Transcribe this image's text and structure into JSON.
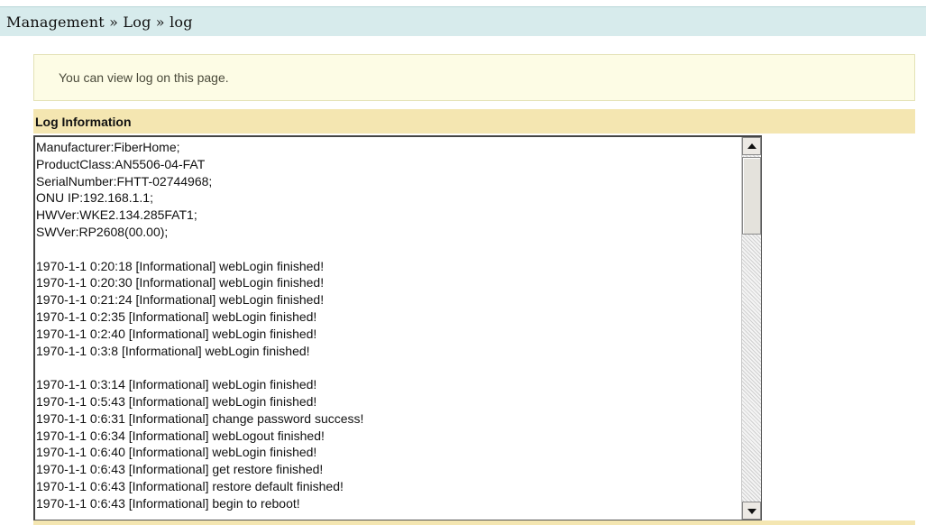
{
  "header": {
    "breadcrumb": "Management » Log » log"
  },
  "info": {
    "text": "You can view log on this page."
  },
  "section": {
    "title": "Log Information"
  },
  "log": {
    "lines": [
      "Manufacturer:FiberHome;",
      "ProductClass:AN5506-04-FAT",
      "SerialNumber:FHTT-02744968;",
      "ONU IP:192.168.1.1;",
      "HWVer:WKE2.134.285FAT1;",
      "SWVer:RP2608(00.00);",
      "",
      "1970-1-1 0:20:18 [Informational] webLogin finished!",
      "1970-1-1 0:20:30 [Informational] webLogin finished!",
      "1970-1-1 0:21:24 [Informational] webLogin finished!",
      "1970-1-1 0:2:35 [Informational] webLogin finished!",
      "1970-1-1 0:2:40 [Informational] webLogin finished!",
      "1970-1-1 0:3:8 [Informational] webLogin finished!",
      "",
      "1970-1-1 0:3:14 [Informational] webLogin finished!",
      "1970-1-1 0:5:43 [Informational] webLogin finished!",
      "1970-1-1 0:6:31 [Informational] change password success!",
      "1970-1-1 0:6:34 [Informational] webLogout finished!",
      "1970-1-1 0:6:40 [Informational] webLogin finished!",
      "1970-1-1 0:6:43 [Informational] get restore finished!",
      "1970-1-1 0:6:43 [Informational] restore default finished!",
      "1970-1-1 0:6:43 [Informational] begin to reboot!"
    ]
  },
  "colors": {
    "topbar_bg": "#d7ebec",
    "info_bg": "#fdfce5",
    "section_bg": "#f4e6b1"
  }
}
